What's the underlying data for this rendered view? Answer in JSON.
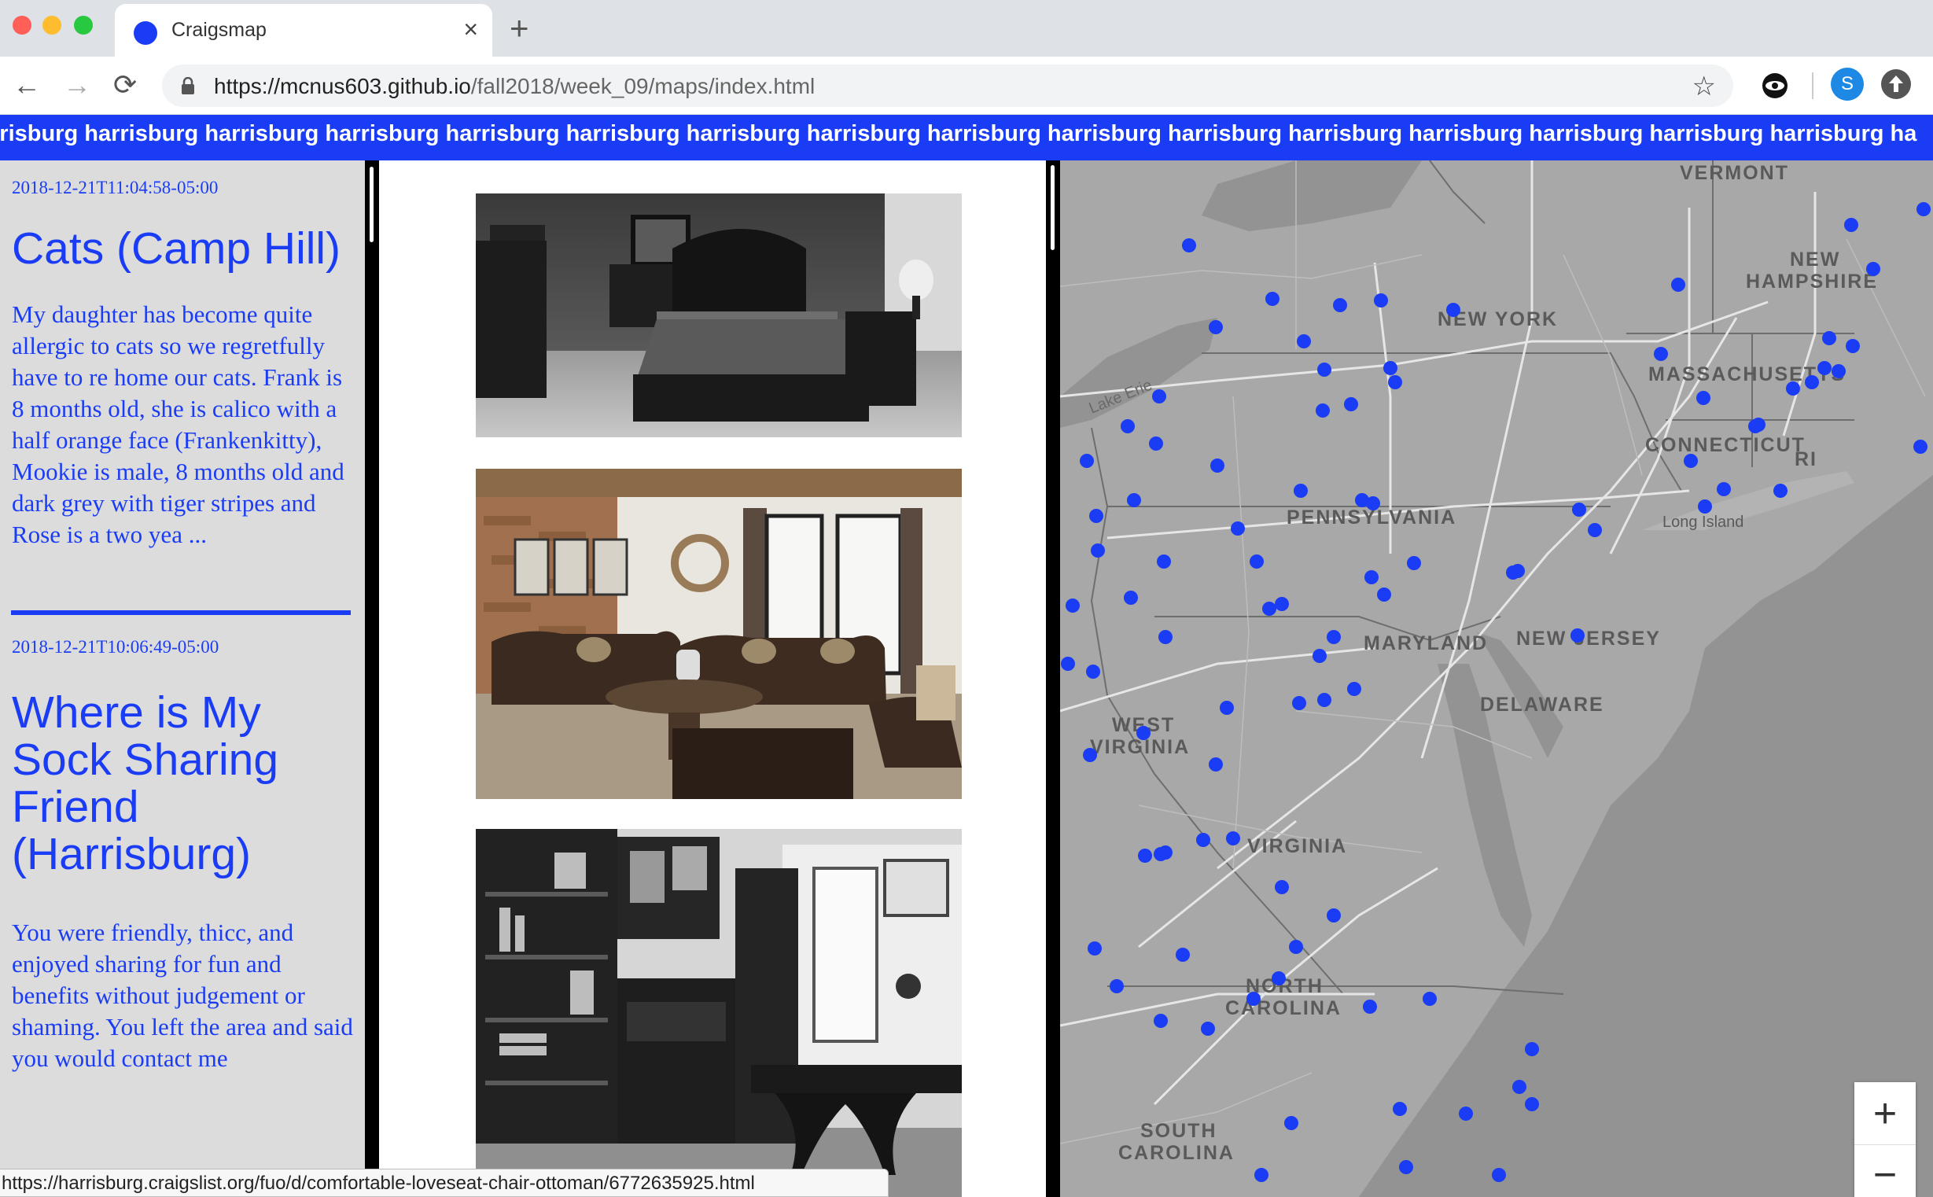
{
  "browser": {
    "tab_title": "Craigsmap",
    "url_host": "https://mcnus603.github.io",
    "url_path": "/fall2018/week_09/maps/index.html",
    "profile_initial": "S",
    "status_url": "https://harrisburg.craigslist.org/fuo/d/comfortable-loveseat-chair-ottoman/6772635925.html"
  },
  "ticker": {
    "text": "rrisburg harrisburg harrisburg harrisburg harrisburg harrisburg harrisburg harrisburg harrisburg  harrisburg harrisburg harrisburg harrisburg harrisburg harrisburg harrisburg ha"
  },
  "posts": [
    {
      "date": "2018-12-21T11:04:58-05:00",
      "title": "Cats (Camp Hill)",
      "body": "My daughter has become quite allergic to cats so we regretfully have to re home our cats. Frank is 8 months old, she is calico with a half orange face (Frankenkitty), Mookie is male, 8 months old and dark grey with tiger stripes and Rose is a two yea ..."
    },
    {
      "date": "2018-12-21T10:06:49-05:00",
      "title": "Where is My Sock Sharing Friend (Harrisburg)",
      "body": "You were friendly, thicc, and enjoyed sharing for fun and benefits without judgement or shaming. You left the area and said you would contact me"
    }
  ],
  "images": [
    {
      "name": "bedroom-set-photo",
      "tone": "grayscale"
    },
    {
      "name": "living-room-sofa-photo",
      "tone": "color"
    },
    {
      "name": "office-desk-bookcase-photo",
      "tone": "grayscale"
    }
  ],
  "map": {
    "labels": {
      "vermont": "VERMONT",
      "new_hampshire_1": "NEW",
      "new_hampshire_2": "HAMPSHIRE",
      "new_york": "NEW YORK",
      "massachusetts": "MASSACHUSETTS",
      "connecticut": "CONNECTICUT",
      "ri": "RI",
      "pennsylvania": "PENNSYLVANIA",
      "long_island": "Long Island",
      "lake_erie": "Lake Erie",
      "maryland": "MARYLAND",
      "new_jersey": "NEW JERSEY",
      "delaware": "DELAWARE",
      "west_virginia_1": "WEST",
      "west_virginia_2": "VIRGINIA",
      "virginia": "VIRGINIA",
      "north_carolina_1": "NORTH",
      "north_carolina_2": "CAROLINA",
      "south_carolina_1": "SOUTH",
      "south_carolina_2": "CAROLINA"
    },
    "marker_color": "#1a3cf5",
    "zoom_in": "+",
    "zoom_out": "−"
  },
  "colors": {
    "accent": "#1a3cf5",
    "map_land": "#a8a8a8",
    "map_water": "#929292",
    "sidebar_bg": "#dcdcdc"
  }
}
